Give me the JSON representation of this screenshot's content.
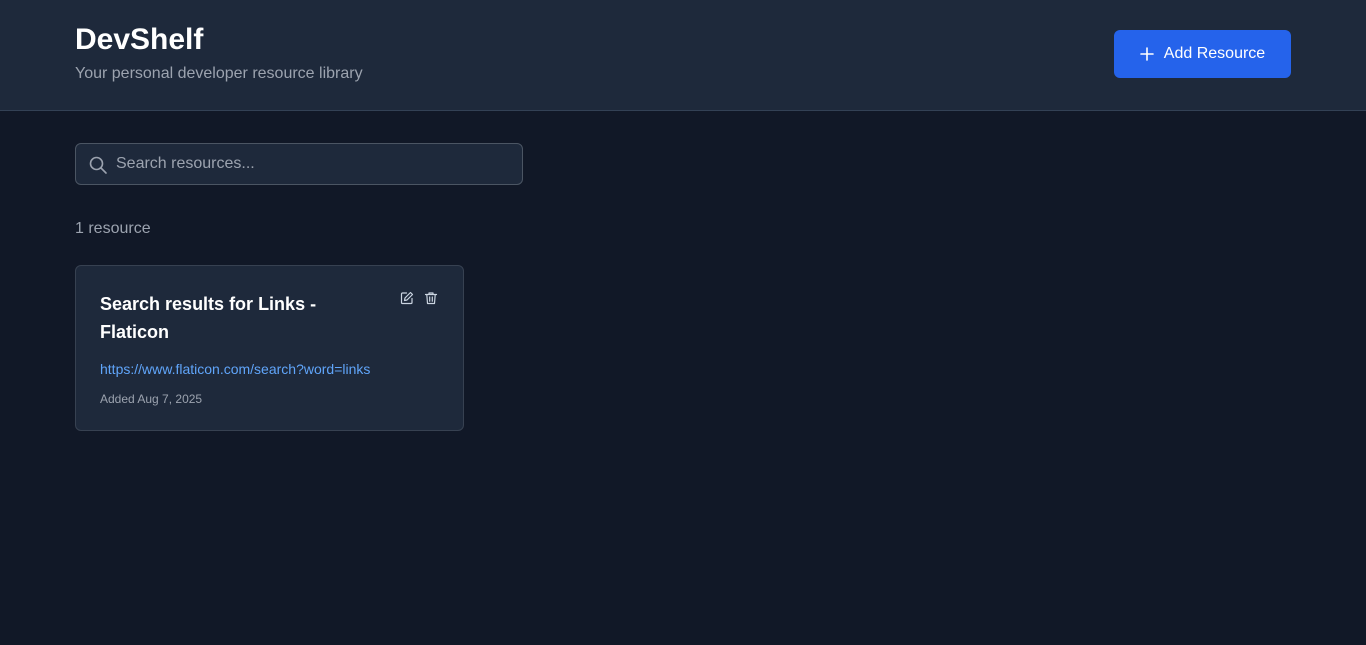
{
  "header": {
    "title": "DevShelf",
    "subtitle": "Your personal developer resource library",
    "add_button_label": "Add Resource",
    "add_button_icon": "plus-icon"
  },
  "search": {
    "placeholder": "Search resources...",
    "value": "",
    "icon": "search-icon"
  },
  "resource_count": "1 resource",
  "resources": [
    {
      "title": "Search results for Links - Flaticon",
      "url": "https://www.flaticon.com/search?word=links",
      "added": "Added Aug 7, 2025",
      "actions": [
        "edit-icon",
        "trash-icon"
      ]
    }
  ],
  "colors": {
    "background": "#111827",
    "header_bg": "#1e293b",
    "card_bg": "#1e293b",
    "accent": "#2563eb",
    "link": "#60a5fa",
    "muted_text": "#9ca3af"
  }
}
